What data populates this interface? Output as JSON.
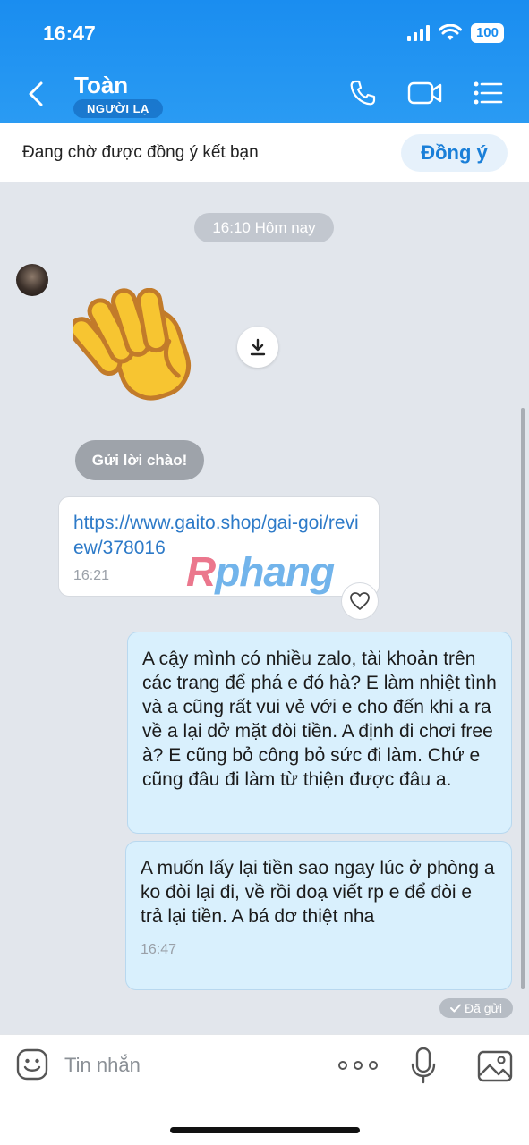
{
  "status_bar": {
    "time": "16:47",
    "battery": "100"
  },
  "header": {
    "contact_name": "Toàn",
    "badge": "NGƯỜI LẠ"
  },
  "friend_request": {
    "text": "Đang chờ được đồng ý kết bạn",
    "accept_label": "Đồng ý"
  },
  "chat": {
    "date_separator": "16:10 Hôm nay",
    "greeting_button": "Gửi lời chào!",
    "link_message": {
      "url": "https://www.gaito.shop/gai-goi/review/378016",
      "time": "16:21"
    },
    "watermark": [
      "R",
      "phang"
    ],
    "outgoing": [
      {
        "text": "A cậy mình có nhiều zalo, tài khoản trên các trang để phá e đó hà? E làm nhiệt tình và a cũng rất vui vẻ với e cho đến khi a ra về a lại dở mặt đòi tiền. A định đi chơi free à? E cũng bỏ công bỏ sức đi làm. Chứ e cũng đâu đi làm từ thiện được đâu a."
      },
      {
        "text": "A muốn lấy lại tiền sao ngay lúc ở phòng a ko đòi lại đi, về rồi doạ viết rp e để đòi e trả lại tiền. A bá dơ thiệt nha",
        "time": "16:47"
      }
    ],
    "sent_status": "Đã gửi"
  },
  "input": {
    "placeholder": "Tin nhắn"
  },
  "colors": {
    "header_blue": "#1a8df0",
    "outgoing_bubble": "#d9f0fd",
    "link_blue": "#2d7ac8"
  }
}
